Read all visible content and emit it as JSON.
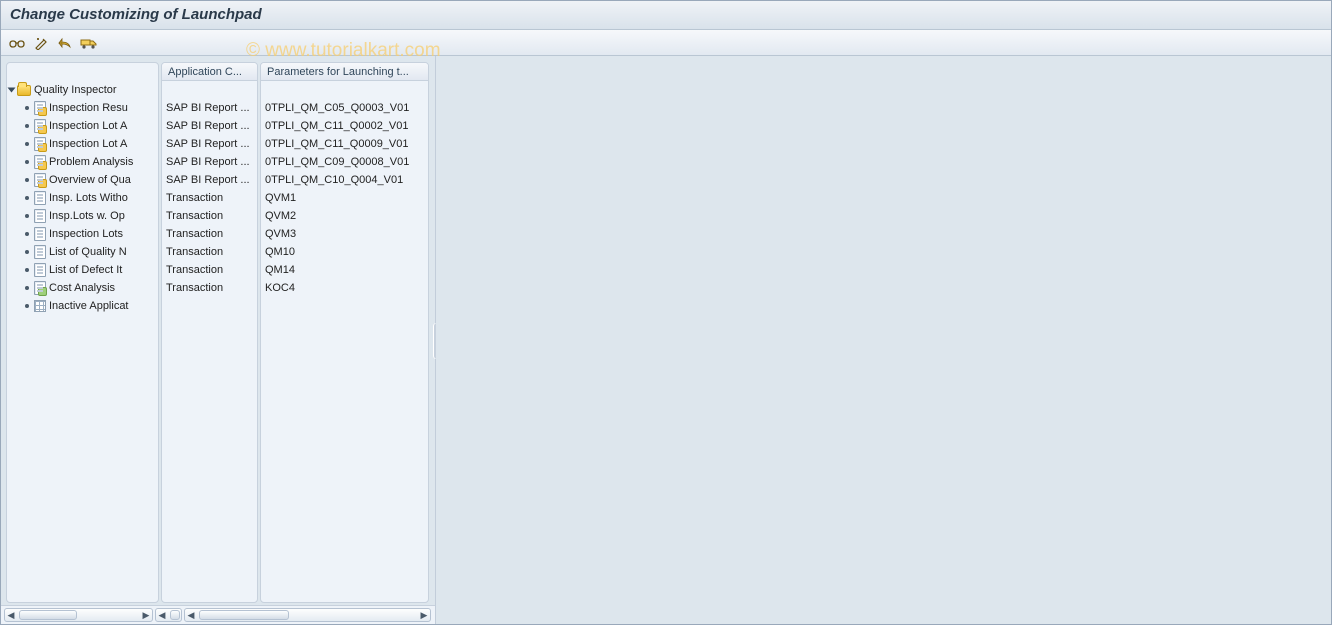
{
  "title": "Change Customizing of Launchpad",
  "watermark": "© www.tutorialkart.com",
  "toolbar": {
    "buttons": [
      "glasses-icon",
      "magic-icon",
      "revert-icon",
      "transport-icon"
    ]
  },
  "columns": {
    "tree_header": "",
    "app_header": "Application C...",
    "param_header": "Parameters for Launching t..."
  },
  "tree": {
    "root_label": "Quality Inspector",
    "items": [
      {
        "label": "Inspection Resu",
        "icon": "bi",
        "app": "SAP BI Report ...",
        "param": "0TPLI_QM_C05_Q0003_V01"
      },
      {
        "label": "Inspection Lot A",
        "icon": "bi",
        "app": "SAP BI Report ...",
        "param": "0TPLI_QM_C11_Q0002_V01"
      },
      {
        "label": "Inspection Lot A",
        "icon": "bi",
        "app": "SAP BI Report ...",
        "param": "0TPLI_QM_C11_Q0009_V01"
      },
      {
        "label": "Problem Analysis",
        "icon": "bi",
        "app": "SAP BI Report ...",
        "param": "0TPLI_QM_C09_Q0008_V01"
      },
      {
        "label": "Overview of Qua",
        "icon": "bi",
        "app": "SAP BI Report ...",
        "param": "0TPLI_QM_C10_Q004_V01"
      },
      {
        "label": "Insp. Lots Witho",
        "icon": "tx",
        "app": "Transaction",
        "param": "QVM1"
      },
      {
        "label": "Insp.Lots w. Op",
        "icon": "tx",
        "app": "Transaction",
        "param": "QVM2"
      },
      {
        "label": "Inspection Lots",
        "icon": "tx",
        "app": "Transaction",
        "param": "QVM3"
      },
      {
        "label": "List of Quality N",
        "icon": "tx",
        "app": "Transaction",
        "param": "QM10"
      },
      {
        "label": "List of Defect It",
        "icon": "tx",
        "app": "Transaction",
        "param": "QM14"
      },
      {
        "label": "Cost Analysis",
        "icon": "cost",
        "app": "Transaction",
        "param": "KOC4"
      },
      {
        "label": "Inactive Applicat",
        "icon": "grid",
        "app": "",
        "param": ""
      }
    ]
  },
  "scroll": {
    "tree_width": 149,
    "app_width": 27,
    "param_width": 250,
    "thumb_tree": 58,
    "thumb_app": 10,
    "thumb_param": 90
  }
}
